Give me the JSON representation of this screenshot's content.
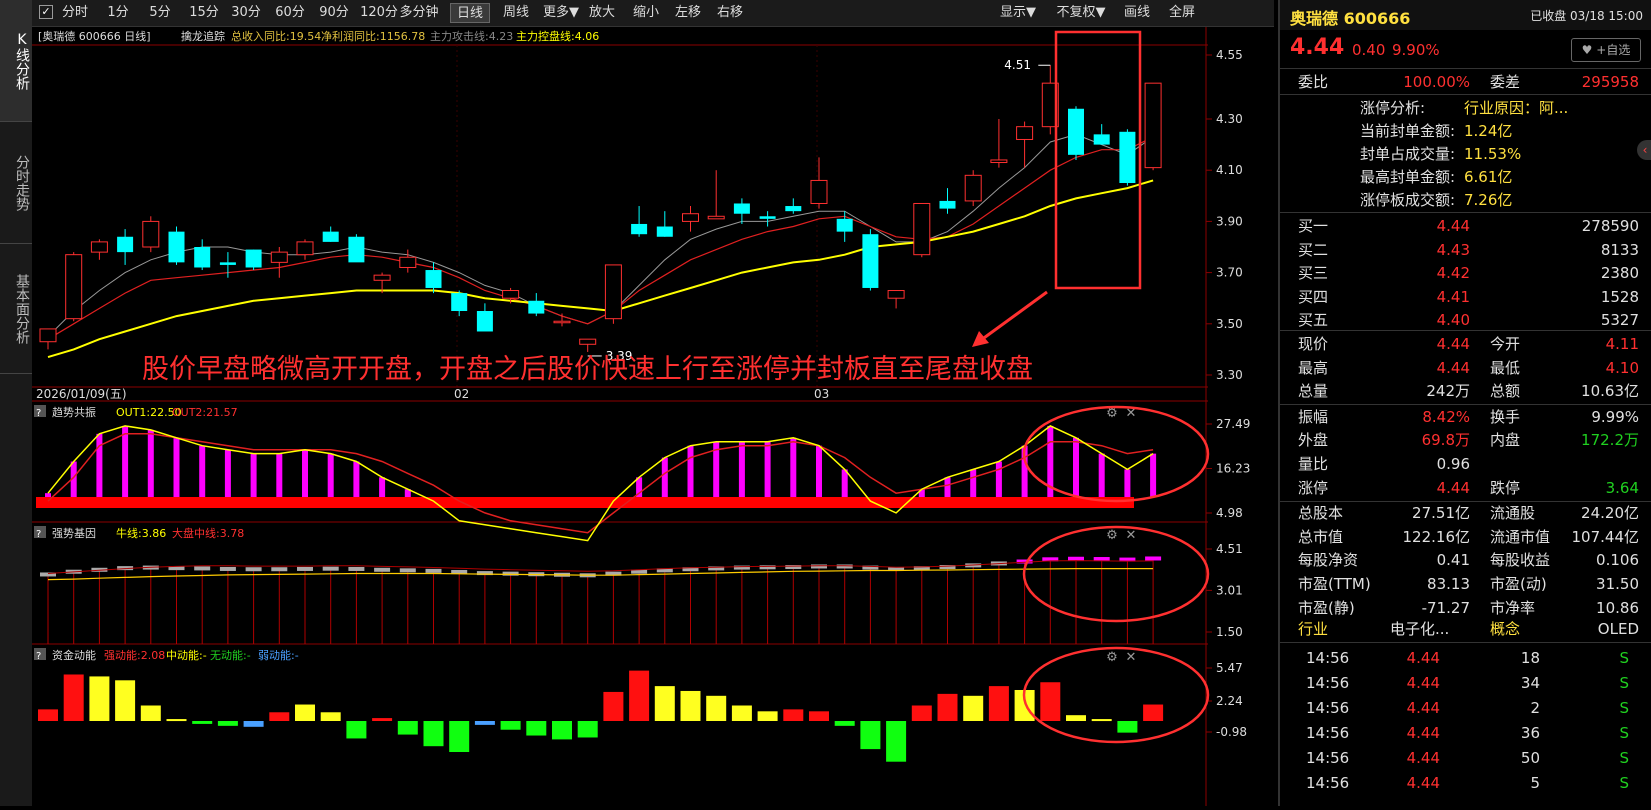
{
  "nav": {
    "kline": "K线分析",
    "fenshi": "分时走势",
    "jiben": "基本面分析"
  },
  "toolbar": {
    "items": [
      "分时",
      "1分",
      "5分",
      "15分",
      "30分",
      "60分",
      "90分",
      "120分",
      "多分钟",
      "日线",
      "周线",
      "更多▼",
      "放大",
      "缩小",
      "左移",
      "右移"
    ],
    "right": [
      "显示▼",
      "不复权▼",
      "画线",
      "全屏"
    ]
  },
  "main_panel": {
    "label": "[奥瑞德 600666 日线]",
    "indicator": "擒龙追踪",
    "rev": "总收入同比:19.54",
    "profit": "净利润同比:1156.78",
    "attack": "主力攻击线:4.23",
    "control": "主力控盘线:4.06",
    "y_ticks": [
      "4.55",
      "4.30",
      "4.10",
      "3.90",
      "3.70",
      "3.50",
      "3.30"
    ],
    "x_labels": [
      "2026/01/09(五)",
      "02",
      "03"
    ],
    "max_label": "4.51",
    "min_label": "3.39",
    "annotation": "股价早盘略微高开开盘，开盘之后股价快速上行至涨停并封板直至尾盘收盘"
  },
  "panel2": {
    "name": "趋势共振",
    "out1": "OUT1:22.50",
    "out2": "OUT2:21.57",
    "y_ticks": [
      "27.49",
      "16.23",
      "4.98"
    ]
  },
  "panel3": {
    "name": "强势基因",
    "niu": "牛线:3.86",
    "dapan": "大盘中线:3.78",
    "y_ticks": [
      "4.51",
      "3.01",
      "1.50"
    ]
  },
  "panel4": {
    "name": "资金动能",
    "strong": "强动能:2.08",
    "mid": "中动能:-",
    "none": "无动能:-",
    "weak": "弱动能:-",
    "y_ticks": [
      "5.47",
      "2.24",
      "-0.98"
    ]
  },
  "chart_data": {
    "type": "candlestick",
    "candles": [
      [
        3.43,
        3.48,
        3.4,
        3.48
      ],
      [
        3.52,
        3.78,
        3.51,
        3.77
      ],
      [
        3.78,
        3.83,
        3.75,
        3.82
      ],
      [
        3.84,
        3.87,
        3.73,
        3.78
      ],
      [
        3.8,
        3.92,
        3.78,
        3.9
      ],
      [
        3.86,
        3.88,
        3.73,
        3.74
      ],
      [
        3.8,
        3.83,
        3.71,
        3.72
      ],
      [
        3.74,
        3.78,
        3.68,
        3.73
      ],
      [
        3.79,
        3.79,
        3.71,
        3.72
      ],
      [
        3.74,
        3.8,
        3.68,
        3.78
      ],
      [
        3.77,
        3.83,
        3.75,
        3.82
      ],
      [
        3.86,
        3.88,
        3.82,
        3.82
      ],
      [
        3.84,
        3.85,
        3.78,
        3.74
      ],
      [
        3.67,
        3.7,
        3.62,
        3.69
      ],
      [
        3.72,
        3.79,
        3.7,
        3.76
      ],
      [
        3.71,
        3.74,
        3.62,
        3.64
      ],
      [
        3.62,
        3.63,
        3.53,
        3.55
      ],
      [
        3.55,
        3.58,
        3.49,
        3.47
      ],
      [
        3.6,
        3.64,
        3.58,
        3.63
      ],
      [
        3.59,
        3.62,
        3.53,
        3.54
      ],
      [
        3.51,
        3.54,
        3.49,
        3.51
      ],
      [
        3.42,
        3.44,
        3.39,
        3.44
      ],
      [
        3.52,
        3.73,
        3.5,
        3.73
      ],
      [
        3.89,
        3.96,
        3.84,
        3.85
      ],
      [
        3.88,
        3.94,
        3.84,
        3.84
      ],
      [
        3.9,
        3.96,
        3.86,
        3.93
      ],
      [
        3.91,
        4.1,
        3.91,
        3.92
      ],
      [
        3.97,
        3.99,
        3.89,
        3.93
      ],
      [
        3.92,
        3.94,
        3.88,
        3.91
      ],
      [
        3.96,
        3.99,
        3.93,
        3.94
      ],
      [
        3.97,
        4.15,
        3.95,
        4.06
      ],
      [
        3.91,
        3.94,
        3.82,
        3.86
      ],
      [
        3.85,
        3.87,
        3.63,
        3.64
      ],
      [
        3.6,
        3.63,
        3.56,
        3.63
      ],
      [
        3.77,
        3.97,
        3.76,
        3.97
      ],
      [
        3.98,
        4.03,
        3.93,
        3.95
      ],
      [
        3.98,
        4.1,
        3.96,
        4.08
      ],
      [
        4.13,
        4.3,
        4.11,
        4.14
      ],
      [
        4.22,
        4.29,
        4.11,
        4.27
      ],
      [
        4.27,
        4.51,
        4.24,
        4.44
      ],
      [
        4.34,
        4.35,
        4.14,
        4.16
      ],
      [
        4.24,
        4.28,
        4.2,
        4.2
      ],
      [
        4.25,
        4.26,
        4.04,
        4.05
      ],
      [
        4.11,
        4.44,
        4.1,
        4.44
      ]
    ],
    "ma_yellow": [
      3.37,
      3.4,
      3.44,
      3.47,
      3.5,
      3.53,
      3.55,
      3.57,
      3.59,
      3.6,
      3.61,
      3.62,
      3.63,
      3.63,
      3.63,
      3.63,
      3.62,
      3.6,
      3.59,
      3.58,
      3.57,
      3.56,
      3.55,
      3.58,
      3.61,
      3.64,
      3.67,
      3.7,
      3.72,
      3.74,
      3.75,
      3.77,
      3.8,
      3.81,
      3.82,
      3.84,
      3.86,
      3.89,
      3.92,
      3.96,
      3.99,
      4.01,
      4.03,
      4.06
    ],
    "ma_red": [
      3.44,
      3.5,
      3.56,
      3.62,
      3.67,
      3.68,
      3.69,
      3.7,
      3.71,
      3.72,
      3.74,
      3.76,
      3.77,
      3.76,
      3.74,
      3.72,
      3.68,
      3.63,
      3.6,
      3.57,
      3.53,
      3.5,
      3.55,
      3.63,
      3.69,
      3.75,
      3.79,
      3.83,
      3.86,
      3.88,
      3.91,
      3.92,
      3.88,
      3.84,
      3.83,
      3.84,
      3.89,
      3.96,
      4.03,
      4.1,
      4.15,
      4.18,
      4.18,
      4.23
    ],
    "ma_gray": [
      3.45,
      3.55,
      3.63,
      3.7,
      3.75,
      3.78,
      3.8,
      3.8,
      3.78,
      3.77,
      3.77,
      3.78,
      3.8,
      3.78,
      3.77,
      3.74,
      3.7,
      3.65,
      3.62,
      3.57,
      3.53,
      3.5,
      3.55,
      3.65,
      3.75,
      3.83,
      3.87,
      3.9,
      3.9,
      3.92,
      3.94,
      3.94,
      3.88,
      3.82,
      3.82,
      3.86,
      3.94,
      4.03,
      4.11,
      4.21,
      4.24,
      4.2,
      4.16,
      4.23
    ],
    "out1": [
      10,
      18,
      25,
      27,
      26,
      24,
      22,
      21,
      20,
      20,
      21,
      20,
      18,
      14,
      11,
      8,
      3,
      2,
      1,
      0,
      -1,
      -2,
      8,
      14,
      19,
      22,
      23,
      23,
      23,
      24,
      22,
      16,
      8,
      5,
      11,
      14,
      16,
      18,
      22,
      27,
      24,
      20,
      16,
      20
    ],
    "out2": [
      8,
      14,
      22,
      25,
      25,
      24,
      23,
      22,
      21,
      21,
      21,
      21,
      20,
      18,
      15,
      12,
      8,
      5,
      3,
      2,
      1,
      0,
      5,
      10,
      15,
      19,
      21,
      22,
      22,
      23,
      22,
      19,
      14,
      10,
      11,
      12,
      14,
      16,
      19,
      23,
      23,
      22,
      20,
      21
    ],
    "gene_bar": [
      3.55,
      3.65,
      3.72,
      3.78,
      3.8,
      3.78,
      3.77,
      3.75,
      3.74,
      3.74,
      3.75,
      3.76,
      3.75,
      3.72,
      3.7,
      3.68,
      3.64,
      3.6,
      3.58,
      3.56,
      3.54,
      3.52,
      3.58,
      3.65,
      3.7,
      3.74,
      3.77,
      3.8,
      3.81,
      3.82,
      3.84,
      3.84,
      3.8,
      3.75,
      3.78,
      3.82,
      3.88,
      3.95,
      4.02,
      4.1,
      4.12,
      4.11,
      4.09,
      4.13
    ],
    "gene_line_yellow": [
      3.4,
      3.42,
      3.45,
      3.48,
      3.51,
      3.53,
      3.55,
      3.57,
      3.58,
      3.59,
      3.6,
      3.61,
      3.62,
      3.62,
      3.62,
      3.62,
      3.61,
      3.6,
      3.59,
      3.58,
      3.57,
      3.56,
      3.56,
      3.58,
      3.6,
      3.62,
      3.64,
      3.66,
      3.68,
      3.7,
      3.71,
      3.72,
      3.73,
      3.73,
      3.74,
      3.75,
      3.76,
      3.77,
      3.78,
      3.79,
      3.8,
      3.8,
      3.8,
      3.8
    ],
    "gene_line_red": [
      3.62,
      3.68,
      3.74,
      3.8,
      3.85,
      3.88,
      3.9,
      3.9,
      3.89,
      3.89,
      3.89,
      3.9,
      3.9,
      3.88,
      3.86,
      3.84,
      3.81,
      3.78,
      3.76,
      3.74,
      3.72,
      3.7,
      3.72,
      3.76,
      3.8,
      3.83,
      3.85,
      3.87,
      3.88,
      3.89,
      3.9,
      3.9,
      3.88,
      3.85,
      3.86,
      3.89,
      3.93,
      3.98,
      4.03,
      4.08,
      4.09,
      4.08,
      4.07,
      4.08
    ],
    "gene_pink_from": 33,
    "fund": [
      1.2,
      4.8,
      4.6,
      4.2,
      1.6,
      0.2,
      -0.3,
      -0.5,
      -0.6,
      0.9,
      1.7,
      0.9,
      -1.8,
      0.3,
      -1.4,
      -2.6,
      -3.2,
      -0.4,
      -0.9,
      -1.5,
      -1.9,
      -1.7,
      3.0,
      5.2,
      3.6,
      3.1,
      2.6,
      1.6,
      1.0,
      1.2,
      1.0,
      -0.5,
      -2.9,
      -4.2,
      1.6,
      2.8,
      2.6,
      3.6,
      3.2,
      4.0,
      0.6,
      0.2,
      -1.2,
      1.7
    ],
    "fund_colors": [
      "r",
      "r",
      "y",
      "y",
      "y",
      "y",
      "g",
      "g",
      "b",
      "r",
      "y",
      "y",
      "g",
      "r",
      "g",
      "g",
      "g",
      "b",
      "g",
      "g",
      "g",
      "g",
      "r",
      "r",
      "y",
      "y",
      "y",
      "y",
      "y",
      "r",
      "r",
      "g",
      "g",
      "g",
      "r",
      "r",
      "y",
      "r",
      "y",
      "r",
      "y",
      "y",
      "g",
      "r"
    ]
  },
  "right_panel": {
    "stock_name": "奥瑞德 600666",
    "status": "已收盘 03/18 15:00",
    "price": "4.44",
    "change": "0.40",
    "pct": "9.90%",
    "watch": "+自选",
    "weibi_label": "委比",
    "weibi": "100.00%",
    "weicha_label": "委差",
    "weicha": "295958",
    "limit_rows": [
      {
        "label": "涨停分析:",
        "value": "行业原因：阿..."
      },
      {
        "label": "当前封单金额:",
        "value": "1.24亿"
      },
      {
        "label": "封单占成交量:",
        "value": "11.53%"
      },
      {
        "label": "最高封单金额:",
        "value": "6.61亿"
      },
      {
        "label": "涨停板成交额:",
        "value": "7.26亿"
      }
    ],
    "bids": [
      {
        "label": "买一",
        "price": "4.44",
        "vol": "278590"
      },
      {
        "label": "买二",
        "price": "4.43",
        "vol": "8133"
      },
      {
        "label": "买三",
        "price": "4.42",
        "vol": "2380"
      },
      {
        "label": "买四",
        "price": "4.41",
        "vol": "1528"
      },
      {
        "label": "买五",
        "price": "4.40",
        "vol": "5327"
      }
    ],
    "stats": [
      {
        "l1": "现价",
        "v1": "4.44",
        "c1": "red",
        "l2": "今开",
        "v2": "4.11",
        "c2": "red"
      },
      {
        "l1": "最高",
        "v1": "4.44",
        "c1": "red",
        "l2": "最低",
        "v2": "4.10",
        "c2": "red"
      },
      {
        "l1": "总量",
        "v1": "242万",
        "c1": "white",
        "l2": "总额",
        "v2": "10.63亿",
        "c2": "white"
      },
      {
        "l1": "振幅",
        "v1": "8.42%",
        "c1": "red",
        "l2": "换手",
        "v2": "9.99%",
        "c2": "white"
      },
      {
        "l1": "外盘",
        "v1": "69.8万",
        "c1": "red",
        "l2": "内盘",
        "v2": "172.2万",
        "c2": "green"
      },
      {
        "l1": "量比",
        "v1": "0.96",
        "c1": "white",
        "l2": "",
        "v2": "",
        "c2": "white"
      },
      {
        "l1": "涨停",
        "v1": "4.44",
        "c1": "red",
        "l2": "跌停",
        "v2": "3.64",
        "c2": "green"
      },
      {
        "l1": "总股本",
        "v1": "27.51亿",
        "c1": "white",
        "l2": "流通股",
        "v2": "24.20亿",
        "c2": "white"
      },
      {
        "l1": "总市值",
        "v1": "122.16亿",
        "c1": "white",
        "l2": "流通市值",
        "v2": "107.44亿",
        "c2": "white"
      },
      {
        "l1": "每股净资",
        "v1": "0.41",
        "c1": "white",
        "l2": "每股收益",
        "v2": "0.106",
        "c2": "white"
      },
      {
        "l1": "市盈(TTM)",
        "v1": "83.13",
        "c1": "white",
        "l2": "市盈(动)",
        "v2": "31.50",
        "c2": "white"
      },
      {
        "l1": "市盈(静)",
        "v1": "-71.27",
        "c1": "white",
        "l2": "市净率",
        "v2": "10.86",
        "c2": "white"
      }
    ],
    "industry_label": "行业",
    "industry": "电子化...",
    "concept_label": "概念",
    "concept": "OLED",
    "ticks": [
      {
        "time": "14:56",
        "price": "4.44",
        "vol": "18",
        "dir": "S"
      },
      {
        "time": "14:56",
        "price": "4.44",
        "vol": "34",
        "dir": "S"
      },
      {
        "time": "14:56",
        "price": "4.44",
        "vol": "2",
        "dir": "S"
      },
      {
        "time": "14:56",
        "price": "4.44",
        "vol": "36",
        "dir": "S"
      },
      {
        "time": "14:56",
        "price": "4.44",
        "vol": "50",
        "dir": "S"
      },
      {
        "time": "14:56",
        "price": "4.44",
        "vol": "5",
        "dir": "S"
      }
    ]
  }
}
